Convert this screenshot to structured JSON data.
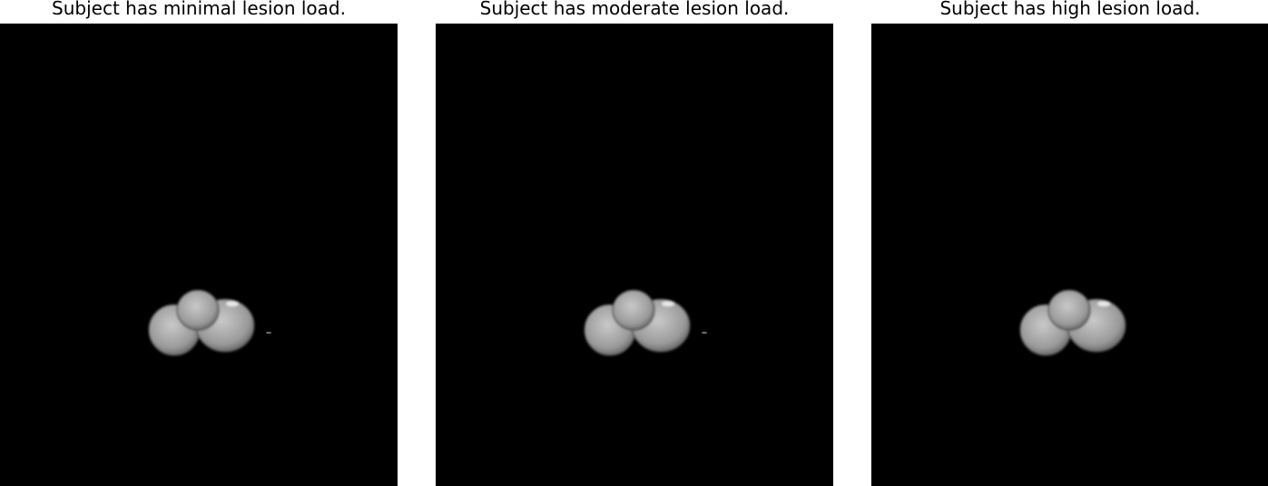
{
  "figure": {
    "panels": [
      {
        "title": "Subject has minimal lesion load.",
        "speck": true
      },
      {
        "title": "Subject has moderate lesion load.",
        "speck": true
      },
      {
        "title": "Subject has high lesion load.",
        "speck": false
      }
    ],
    "colors": {
      "background": "#ffffff",
      "scan_background": "#000000",
      "tissue_light": "#c9c9c9",
      "tissue_mid": "#9a9a9a",
      "tissue_dark": "#5a5a5a"
    }
  }
}
